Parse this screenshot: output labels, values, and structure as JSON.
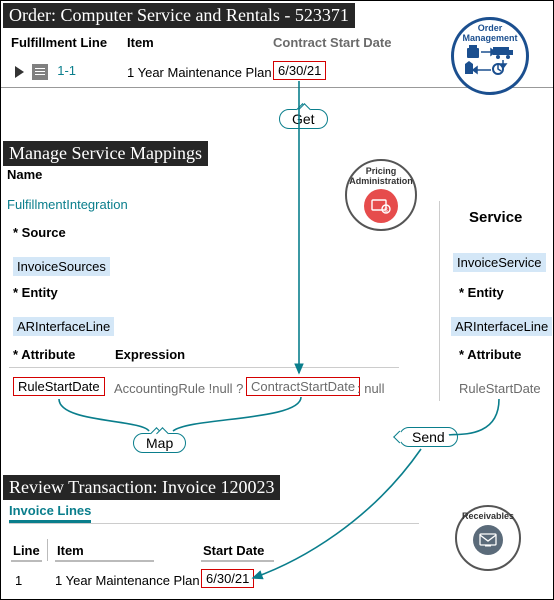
{
  "order": {
    "title": "Order: Computer Service and Rentals - 523371",
    "headers": {
      "fulfillment_line": "Fulfillment Line",
      "item": "Item",
      "contract_start_date": "Contract Start Date"
    },
    "row": {
      "line": "1-1",
      "item": "1 Year Maintenance Plan",
      "date": "6/30/21"
    },
    "badge_label": "Order Management"
  },
  "callouts": {
    "get": "Get",
    "map": "Map",
    "send": "Send"
  },
  "mapping": {
    "title": "Manage Service Mappings",
    "name_label": "Name",
    "name_value": "FulfillmentIntegration",
    "source_label": "Source",
    "source_value": "InvoiceSources",
    "entity_label": "Entity",
    "entity_value": "ARInterfaceLine",
    "attribute_label": "Attribute",
    "expression_label": "Expression",
    "attr_value": "RuleStartDate",
    "expr_left": "AccountingRule !null ?",
    "expr_mid": "ContractStartDate",
    "expr_right": ": null",
    "pricing_label": "Pricing Administration"
  },
  "service": {
    "heading": "Service",
    "value": "InvoiceService",
    "entity_label": "Entity",
    "entity_value": "ARInterfaceLine",
    "attribute_label": "Attribute",
    "attribute_value": "RuleStartDate"
  },
  "invoice": {
    "title": "Review Transaction: Invoice 120023",
    "tab": "Invoice Lines",
    "headers": {
      "line": "Line",
      "item": "Item",
      "start_date": "Start Date"
    },
    "row": {
      "line": "1",
      "item": "1 Year Maintenance Plan",
      "date": "6/30/21"
    },
    "badge_label": "Receivables"
  }
}
